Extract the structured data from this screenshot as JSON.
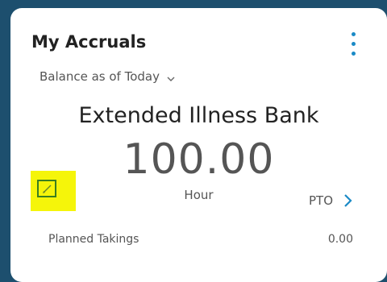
{
  "card": {
    "title": "My Accruals",
    "balance_selector": "Balance as of Today",
    "bank_name": "Extended Illness Bank",
    "amount": "100.00",
    "unit": "Hour",
    "link_label": "PTO",
    "planned_takings": {
      "label": "Planned Takings",
      "value": "0.00"
    }
  },
  "colors": {
    "background": "#1d4f6e",
    "card": "#ffffff",
    "accent": "#1b8ac6",
    "highlight": "#f5f50a",
    "edit_box_border": "#3a7f1f"
  },
  "icons": {
    "menu": "kebab-menu-icon",
    "balance_dropdown": "chevron-down-icon",
    "edit": "pencil-icon",
    "link": "chevron-right-icon"
  }
}
